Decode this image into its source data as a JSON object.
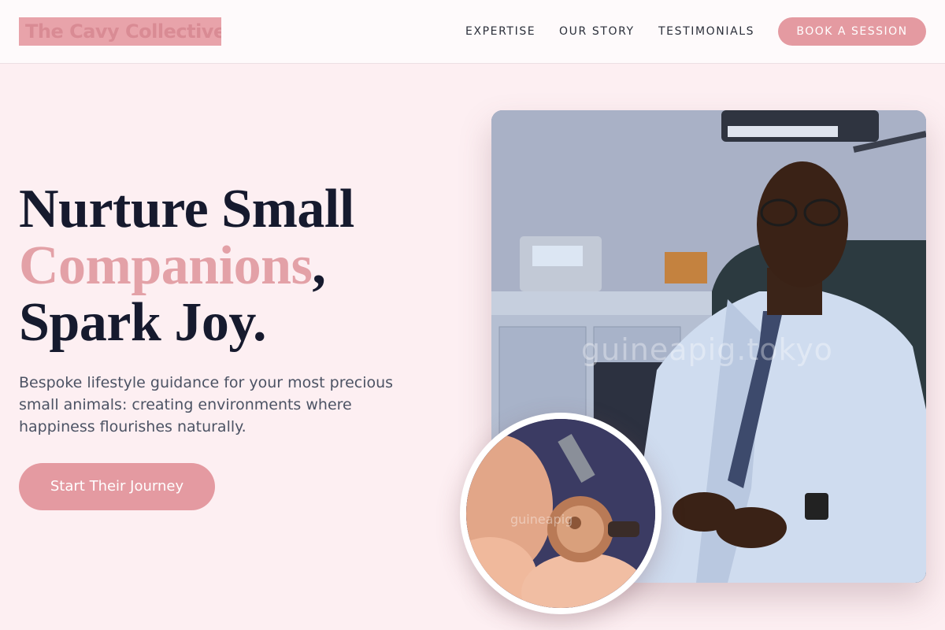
{
  "header": {
    "logo": "The Cavy Collective",
    "nav": {
      "expertise": "EXPERTISE",
      "our_story": "OUR STORY",
      "testimonials": "TESTIMONIALS"
    },
    "book_button": "BOOK A SESSION"
  },
  "hero": {
    "headline_line1": "Nurture Small",
    "headline_accent": "Companions",
    "headline_comma": ",",
    "headline_line3": "Spark Joy.",
    "subtext": "Bespoke lifestyle guidance for your most precious small animals: creating environments where happiness flourishes naturally.",
    "cta": "Start Their Journey"
  },
  "media": {
    "main_image_watermark": "guineapig.tokyo",
    "inset_watermark": "guineapig"
  },
  "colors": {
    "accent": "#e49aa1",
    "background": "#fdeff2",
    "heading": "#161a2e",
    "body_text": "#4c5364"
  }
}
